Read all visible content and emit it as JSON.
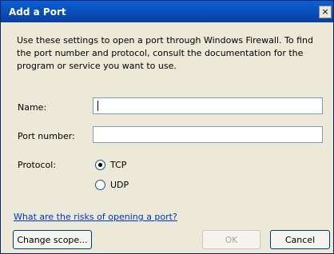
{
  "window": {
    "title": "Add a Port",
    "close_glyph": "×"
  },
  "description": "Use these settings to open a port through Windows Firewall. To find the port number and protocol, consult the documentation for the program or service you want to use.",
  "fields": {
    "name_label": "Name:",
    "name_value": "",
    "port_label": "Port number:",
    "port_value": ""
  },
  "protocol": {
    "label": "Protocol:",
    "options": [
      {
        "label": "TCP",
        "selected": true
      },
      {
        "label": "UDP",
        "selected": false
      }
    ]
  },
  "link_text": "What are the risks of opening a port?",
  "buttons": {
    "change_scope": "Change scope...",
    "ok": "OK",
    "cancel": "Cancel"
  }
}
